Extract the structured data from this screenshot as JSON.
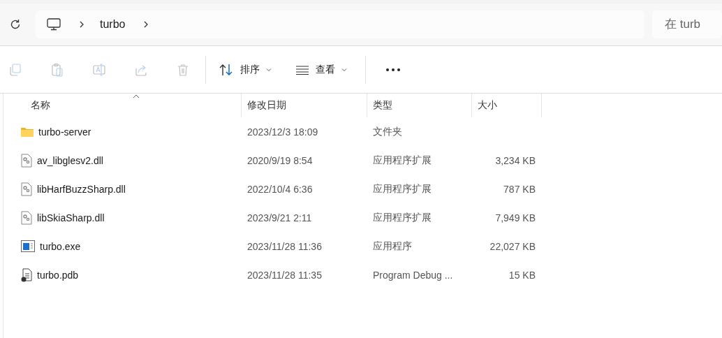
{
  "address_bar": {
    "segments": [
      "turbo"
    ]
  },
  "search": {
    "placeholder": "在 turb"
  },
  "toolbar": {
    "actions": [
      {
        "kind": "copy",
        "disabled": true
      },
      {
        "kind": "paste",
        "disabled": true
      },
      {
        "kind": "rename",
        "disabled": true
      },
      {
        "kind": "share",
        "disabled": true
      },
      {
        "kind": "delete",
        "disabled": true
      }
    ],
    "menus": [
      {
        "kind": "sort",
        "label": "排序"
      },
      {
        "kind": "view",
        "label": "查看"
      }
    ]
  },
  "table": {
    "columns": [
      {
        "label": "名称",
        "sorted": true
      },
      {
        "label": "修改日期",
        "sorted": false
      },
      {
        "label": "类型",
        "sorted": false
      },
      {
        "label": "大小",
        "sorted": false
      }
    ],
    "rows": [
      {
        "kind": "folder",
        "name": "turbo-server",
        "modified": "2023/12/3 18:09",
        "type": "文件夹"
      },
      {
        "kind": "dll",
        "name": "av_libglesv2.dll",
        "modified": "2020/9/19 8:54",
        "type": "应用程序扩展",
        "size": "3,234 KB"
      },
      {
        "kind": "dll",
        "name": "libHarfBuzzSharp.dll",
        "modified": "2022/10/4 6:36",
        "type": "应用程序扩展",
        "size": "787 KB"
      },
      {
        "kind": "dll",
        "name": "libSkiaSharp.dll",
        "modified": "2023/9/21 2:11",
        "type": "应用程序扩展",
        "size": "7,949 KB"
      },
      {
        "kind": "exe",
        "name": "turbo.exe",
        "modified": "2023/11/28 11:36",
        "type": "应用程序",
        "size": "22,027 KB"
      },
      {
        "kind": "pdb",
        "name": "turbo.pdb",
        "modified": "2023/11/28 11:35",
        "type": "Program Debug ...",
        "size": "15 KB"
      }
    ]
  }
}
